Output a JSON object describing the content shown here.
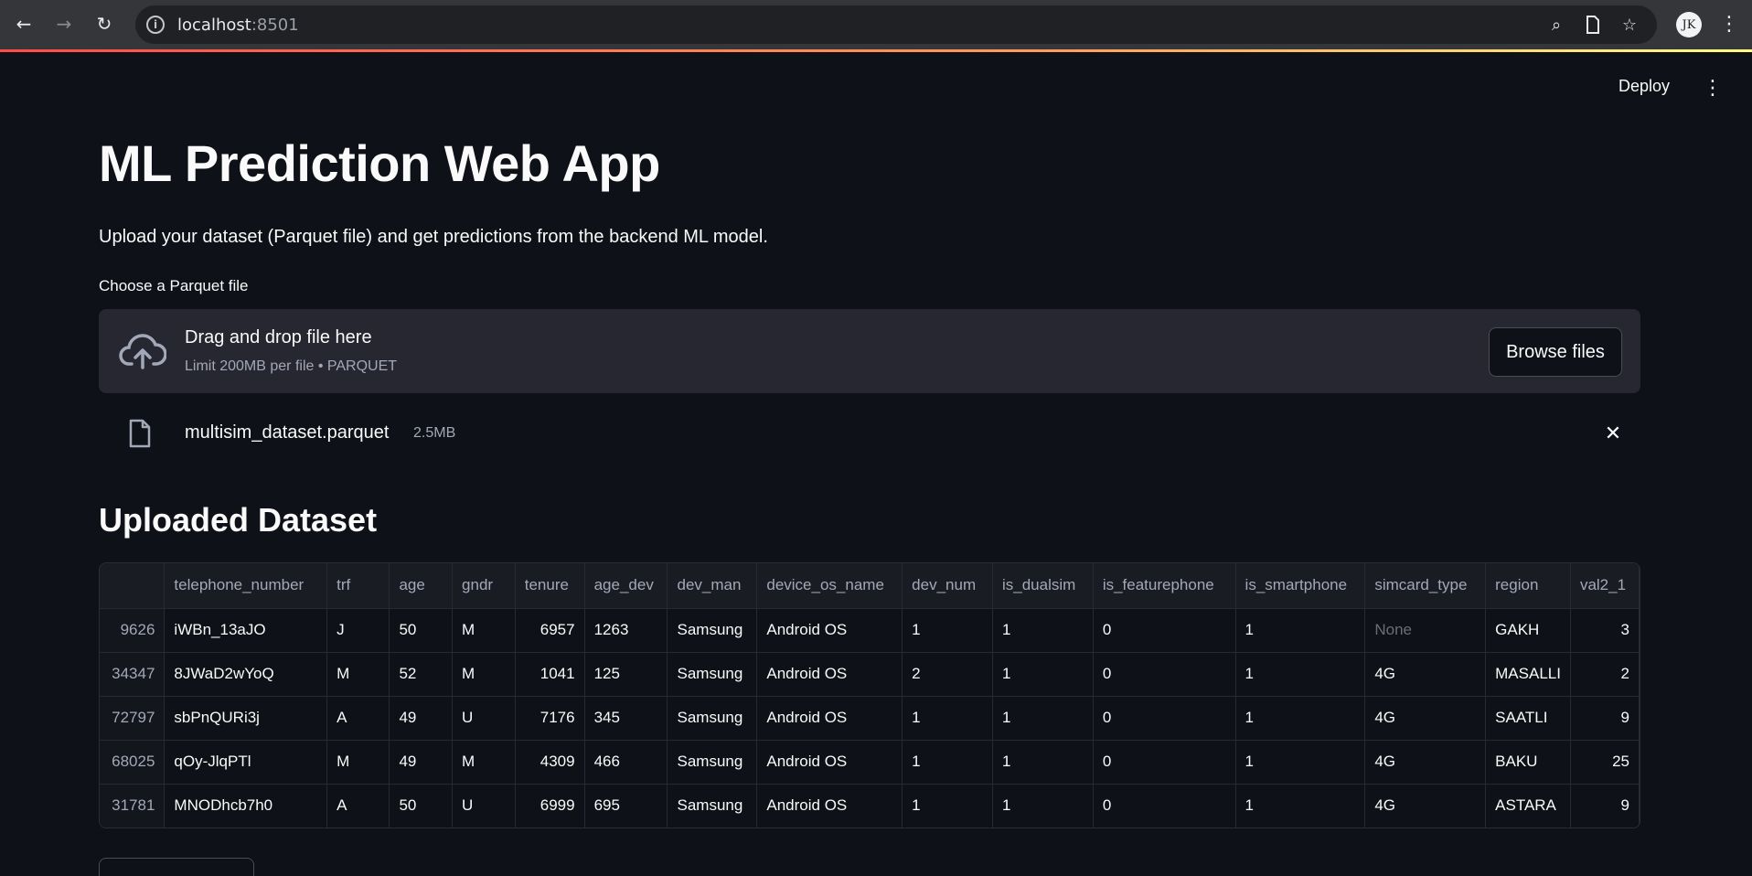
{
  "browser": {
    "url_host": "localhost",
    "url_port": ":8501",
    "avatar_label": "JK"
  },
  "header": {
    "deploy_label": "Deploy"
  },
  "main": {
    "title": "ML Prediction Web App",
    "subtitle": "Upload your dataset (Parquet file) and get predictions from the backend ML model.",
    "uploader_label": "Choose a Parquet file",
    "dropzone_title": "Drag and drop file here",
    "dropzone_limit": "Limit 200MB per file • PARQUET",
    "browse_label": "Browse files",
    "file_name": "multisim_dataset.parquet",
    "file_size": "2.5MB",
    "section_heading": "Uploaded Dataset"
  },
  "table": {
    "columns": [
      "",
      "telephone_number",
      "trf",
      "age",
      "gndr",
      "tenure",
      "age_dev",
      "dev_man",
      "device_os_name",
      "dev_num",
      "is_dualsim",
      "is_featurephone",
      "is_smartphone",
      "simcard_type",
      "region",
      "val2_1"
    ],
    "rows": [
      [
        "9626",
        "iWBn_13aJO",
        "J",
        "50",
        "M",
        "6957",
        "1263",
        "Samsung",
        "Android OS",
        "1",
        "1",
        "0",
        "1",
        "None",
        "GAKH",
        "3"
      ],
      [
        "34347",
        "8JWaD2wYoQ",
        "M",
        "52",
        "M",
        "1041",
        "125",
        "Samsung",
        "Android OS",
        "2",
        "1",
        "0",
        "1",
        "4G",
        "MASALLI",
        "2"
      ],
      [
        "72797",
        "sbPnQURi3j",
        "A",
        "49",
        "U",
        "7176",
        "345",
        "Samsung",
        "Android OS",
        "1",
        "1",
        "0",
        "1",
        "4G",
        "SAATLI",
        "9"
      ],
      [
        "68025",
        "qOy-JlqPTl",
        "M",
        "49",
        "M",
        "4309",
        "466",
        "Samsung",
        "Android OS",
        "1",
        "1",
        "0",
        "1",
        "4G",
        "BAKU",
        "25"
      ],
      [
        "31781",
        "MNODhcb7h0",
        "A",
        "50",
        "U",
        "6999",
        "695",
        "Samsung",
        "Android OS",
        "1",
        "1",
        "0",
        "1",
        "4G",
        "ASTARA",
        "9"
      ]
    ]
  },
  "icons": {
    "back": "back-arrow-icon",
    "forward": "forward-arrow-icon",
    "reload": "reload-icon",
    "info": "info-icon",
    "zoom": "zoom-icon",
    "page": "page-icon",
    "bookmark": "star-icon",
    "menu": "kebab-menu-icon",
    "upload": "cloud-upload-icon",
    "file": "file-icon",
    "close": "close-icon"
  }
}
